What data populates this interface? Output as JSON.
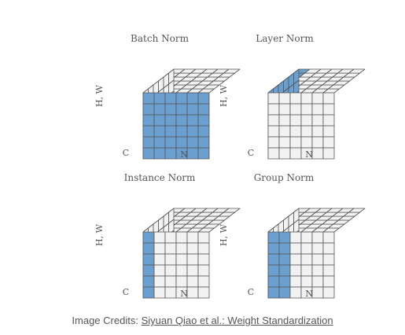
{
  "panels": [
    {
      "title": "Batch Norm",
      "axis_hw": "H, W",
      "axis_c": "C",
      "axis_n": "N",
      "normalized": "batch"
    },
    {
      "title": "Layer Norm",
      "axis_hw": "H, W",
      "axis_c": "C",
      "axis_n": "N",
      "normalized": "layer"
    },
    {
      "title": "Instance Norm",
      "axis_hw": "H, W",
      "axis_c": "C",
      "axis_n": "N",
      "normalized": "instance"
    },
    {
      "title": "Group Norm",
      "axis_hw": "H, W",
      "axis_c": "C",
      "axis_n": "N",
      "normalized": "group"
    }
  ],
  "caption": {
    "prefix": "Image Credits: ",
    "link_text": "Siyuan Qiao et al.: Weight Standardization"
  },
  "colors": {
    "highlight": "#6b9fd0",
    "cell_fill": "#f2f2f2",
    "line": "#555555",
    "label": "#555555"
  }
}
